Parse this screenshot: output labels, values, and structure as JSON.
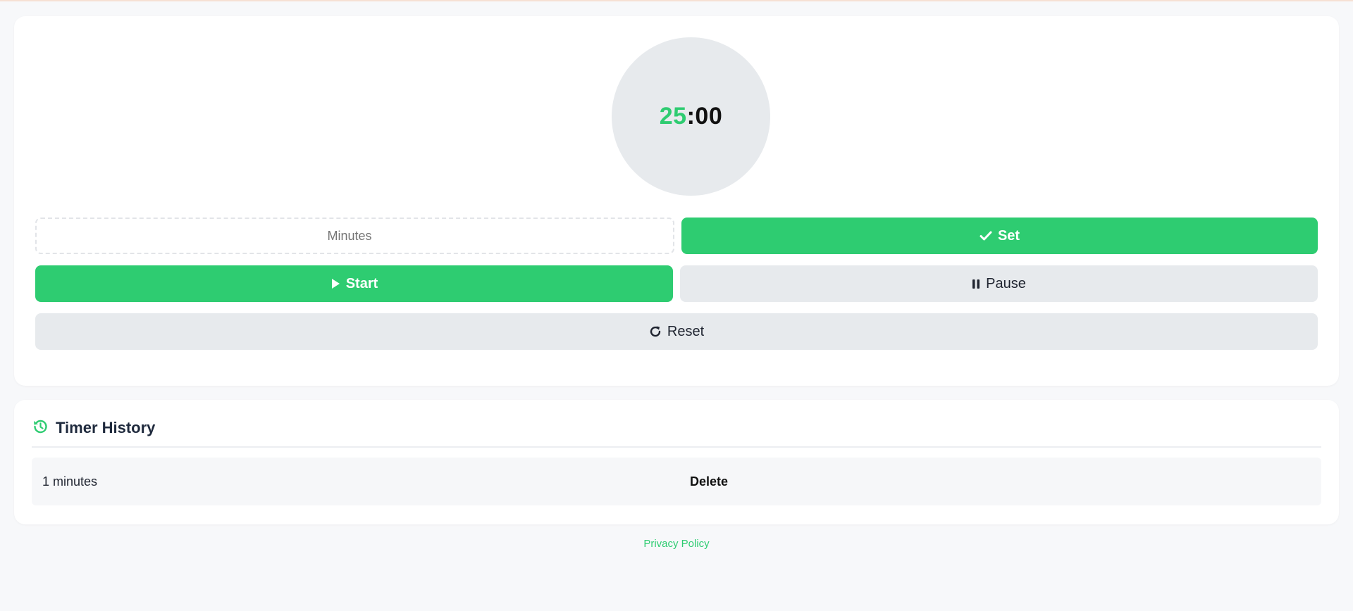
{
  "timer": {
    "minutes": "25",
    "separator": ":",
    "seconds": "00"
  },
  "controls": {
    "minutes_placeholder": "Minutes",
    "minutes_value": "",
    "set_label": "Set",
    "start_label": "Start",
    "pause_label": "Pause",
    "reset_label": "Reset"
  },
  "icons": {
    "set": "check-icon",
    "start": "play-icon",
    "pause": "pause-icon",
    "reset": "rotate-right-icon",
    "history": "history-icon"
  },
  "history": {
    "title": "Timer History",
    "entries": [
      {
        "duration": "1 minutes",
        "delete_label": "Delete"
      }
    ]
  },
  "footer": {
    "privacy_label": "Privacy Policy"
  },
  "colors": {
    "accent": "#2ecc71",
    "neutral_button": "#e7eaed",
    "page_background": "#f7f8fa"
  }
}
